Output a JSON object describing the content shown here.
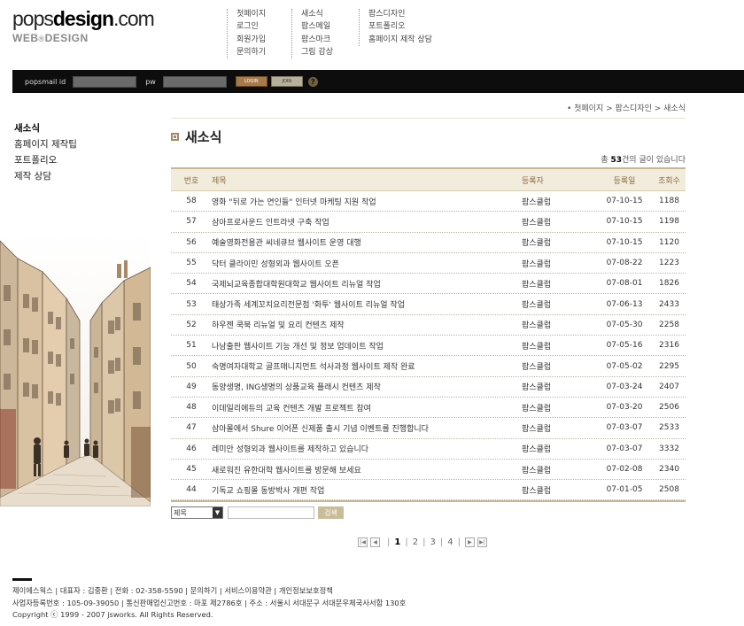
{
  "logo": {
    "main_pre": "pops",
    "main_bold": "design",
    "main_post": ".com",
    "sub_pre": "WEB",
    "sub_mark": "®",
    "sub_post": "DESIGN"
  },
  "gnav": {
    "col1": [
      "첫페이지",
      "로그인",
      "회원가입",
      "문의하기"
    ],
    "col2": [
      "새소식",
      "팝스메일",
      "팝스마크",
      "그림 감상"
    ],
    "col3": [
      "팝스디자인",
      "포트폴리오",
      "홈페이지 제작 상담"
    ]
  },
  "login": {
    "id_label": "popsmail id",
    "pw_label": "pw",
    "login_btn": "LOGIN",
    "join_btn": "JOIN",
    "help": "?"
  },
  "lnb": [
    "새소식",
    "홈페이지 제작팁",
    "포트폴리오",
    "제작 상담"
  ],
  "breadcrumb": "• 첫페이지 > 팝스디자인 > 새소식",
  "page_title": "새소식",
  "count": {
    "pre": "총 ",
    "num": "53",
    "post": "건의 글이 있습니다"
  },
  "table": {
    "headers": {
      "no": "번호",
      "title": "제목",
      "writer": "등록자",
      "date": "등록일",
      "hits": "조회수"
    },
    "rows": [
      {
        "no": "58",
        "title": "영화 \"뒤로 가는 연인들\" 인터넷 마케팅 지원 작업",
        "writer": "팝스클럽",
        "date": "07-10-15",
        "hits": "1188"
      },
      {
        "no": "57",
        "title": "삼아프로사운드 인트라넷 구축 작업",
        "writer": "팝스클럽",
        "date": "07-10-15",
        "hits": "1198"
      },
      {
        "no": "56",
        "title": "예술영화전용관 씨네큐브 웹사이트 운영 대행",
        "writer": "팝스클럽",
        "date": "07-10-15",
        "hits": "1120"
      },
      {
        "no": "55",
        "title": "닥터 클라이민 성형외과 웹사이트 오픈",
        "writer": "팝스클럽",
        "date": "07-08-22",
        "hits": "1223"
      },
      {
        "no": "54",
        "title": "국제뇌교육종합대학원대학교 웹사이트 리뉴얼 작업",
        "writer": "팝스클럽",
        "date": "07-08-01",
        "hits": "1826"
      },
      {
        "no": "53",
        "title": "태상가족 세계꼬치요리전문점 '화투' 웹사이트 리뉴얼 작업",
        "writer": "팝스클럽",
        "date": "07-06-13",
        "hits": "2433"
      },
      {
        "no": "52",
        "title": "하우젠 쿡북 리뉴얼 및 요리 컨텐츠 제작",
        "writer": "팝스클럽",
        "date": "07-05-30",
        "hits": "2258"
      },
      {
        "no": "51",
        "title": "나남출판 웹사이트 기능 개선 및 정보 업데이트 작업",
        "writer": "팝스클럽",
        "date": "07-05-16",
        "hits": "2316"
      },
      {
        "no": "50",
        "title": "숙명여자대학교 골프매니지먼트 석사과정 웹사이트 제작 완료",
        "writer": "팝스클럽",
        "date": "07-05-02",
        "hits": "2295"
      },
      {
        "no": "49",
        "title": "동양생명, ING생명의 상품교육 플래시 컨텐츠 제작",
        "writer": "팝스클럽",
        "date": "07-03-24",
        "hits": "2407"
      },
      {
        "no": "48",
        "title": "이데일리에듀의 교육 컨텐츠 개발 프로젝트 참여",
        "writer": "팝스클럽",
        "date": "07-03-20",
        "hits": "2506"
      },
      {
        "no": "47",
        "title": "삼아몰에서 Shure 이어폰 신제품 출시 기념 이벤트를 진행합니다",
        "writer": "팝스클럽",
        "date": "07-03-07",
        "hits": "2533"
      },
      {
        "no": "46",
        "title": "레미안 성형외과 웹사이트를 제작하고 있습니다",
        "writer": "팝스클럽",
        "date": "07-03-07",
        "hits": "3332"
      },
      {
        "no": "45",
        "title": "새로워진 유한대학 웹사이트를 방문해 보세요",
        "writer": "팝스클럽",
        "date": "07-02-08",
        "hits": "2340"
      },
      {
        "no": "44",
        "title": "기독교 쇼핑몰 동방박사 개편 작업",
        "writer": "팝스클럽",
        "date": "07-01-05",
        "hits": "2508"
      }
    ]
  },
  "search": {
    "select_value": "제목",
    "button": "검색"
  },
  "pager": {
    "pages": [
      "1",
      "2",
      "3",
      "4"
    ],
    "current": "1",
    "first": "|◀",
    "prev": "◀",
    "next": "▶",
    "last": "▶|"
  },
  "footer": {
    "line1": "제이에스웍스 | 대표자 : 김중환 | 전화 : 02-358-5590 | 문의하기 | 서비스이용약관 | 개인정보보호정책",
    "line2": "사업자등록번호 : 105-09-39050 | 통신판매업신고번호 : 마포 제2786호 | 주소 : 서울시 서대문구 서대문우체국사서함 130호",
    "line3": "Copyright ⓒ 1999 - 2007 jsworks. All Rights Reserved."
  },
  "colors": {
    "accent": "#a08a66",
    "table_head_bg": "#f2ecdc",
    "login_bar": "#0d0d0d"
  }
}
